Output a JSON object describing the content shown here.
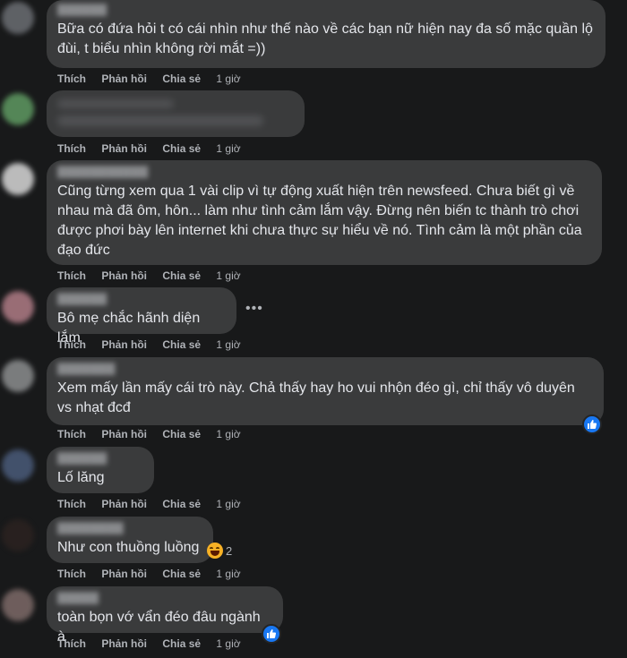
{
  "actions": {
    "like": "Thích",
    "reply": "Phản hồi",
    "share": "Chia sẻ",
    "time": "1 giờ"
  },
  "comments": [
    {
      "text": "Bữa có đứa hỏi t có cái nhìn như thế nào về các bạn nữ hiện nay đa số mặc quần lộ đùi, t biểu nhìn không rời mắt =))"
    },
    {
      "text": ""
    },
    {
      "text": "Cũng từng xem qua 1 vài clip vì tự động xuất hiện trên newsfeed. Chưa biết gì về nhau mà đã ôm, hôn... làm như tình cảm lắm vậy. Đừng nên biến tc thành trò chơi được phơi bày lên internet khi chưa thực sự hiểu về nó. Tình cảm là một phần của đạo đức"
    },
    {
      "text": "Bô mẹ chắc hãnh diện lắm"
    },
    {
      "text": "Xem mấy lần mấy cái trò này. Chả thấy hay ho vui nhộn đéo gì, chỉ thấy vô duyên vs nhạt đcđ"
    },
    {
      "text": "Lố lăng"
    },
    {
      "text": "Như con thuồng luồng",
      "reaction_count": "2"
    },
    {
      "text": "toàn bọn vớ vẩn đéo đâu ngành à"
    }
  ],
  "colors": {
    "background": "#18191a",
    "bubble": "#3a3b3c",
    "like_blue": "#1877f2",
    "haha_yellow": "#f7b125"
  }
}
